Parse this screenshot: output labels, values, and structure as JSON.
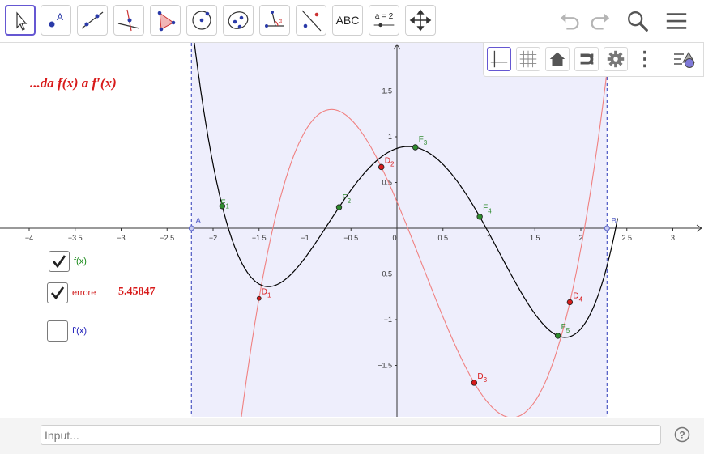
{
  "toolbar": {
    "tools": [
      {
        "name": "move-tool",
        "text": ""
      },
      {
        "name": "point-tool",
        "text": ""
      },
      {
        "name": "line-tool",
        "text": ""
      },
      {
        "name": "perpendicular-line-tool",
        "text": ""
      },
      {
        "name": "polygon-tool",
        "text": ""
      },
      {
        "name": "circle-tool",
        "text": ""
      },
      {
        "name": "ellipse-tool",
        "text": ""
      },
      {
        "name": "angle-tool",
        "text": ""
      },
      {
        "name": "reflect-tool",
        "text": ""
      },
      {
        "name": "text-tool",
        "text": "ABC"
      },
      {
        "name": "slider-tool",
        "text": "a = 2"
      },
      {
        "name": "move-graphics-view-tool",
        "text": ""
      }
    ]
  },
  "graphics": {
    "title_text": "...da f(x) a f′(x)",
    "error_value": "5.45847",
    "x_ticks": [
      "−4",
      "−3.5",
      "−3",
      "−2.5",
      "−2",
      "−1.5",
      "−1",
      "−0.5",
      "0",
      "0.5",
      "1",
      "1.5",
      "2",
      "2.5",
      "3"
    ],
    "y_ticks": [
      "1.5",
      "1",
      "0.5",
      "−0.5",
      "−1",
      "−1.5"
    ],
    "points": {
      "A": "A",
      "B": "B",
      "F1": "F",
      "F1_sub": "1",
      "F2": "F",
      "F2_sub": "2",
      "F3": "F",
      "F3_sub": "3",
      "F4": "F",
      "F4_sub": "4",
      "F5": "F",
      "F5_sub": "5",
      "D1": "D",
      "D1_sub": "1",
      "D2": "D",
      "D2_sub": "2",
      "D3": "D",
      "D3_sub": "3",
      "D4": "D",
      "D4_sub": "4"
    }
  },
  "checkboxes": [
    {
      "label": "f(x)",
      "checked": true,
      "color": "#1a8a1a"
    },
    {
      "label": "errore",
      "checked": true,
      "color": "#d01b1b"
    },
    {
      "label": "f'(x)",
      "checked": false,
      "color": "#1a1ab8"
    }
  ],
  "input": {
    "placeholder": "Input..."
  },
  "colors": {
    "accent": "#6557d2",
    "f_curve": "#000000",
    "fprime_curve": "#f08080",
    "points_green": "#2e8b2e",
    "points_red": "#d81b1b",
    "region": "#eeeefc",
    "boundary": "#5a64c8"
  }
}
